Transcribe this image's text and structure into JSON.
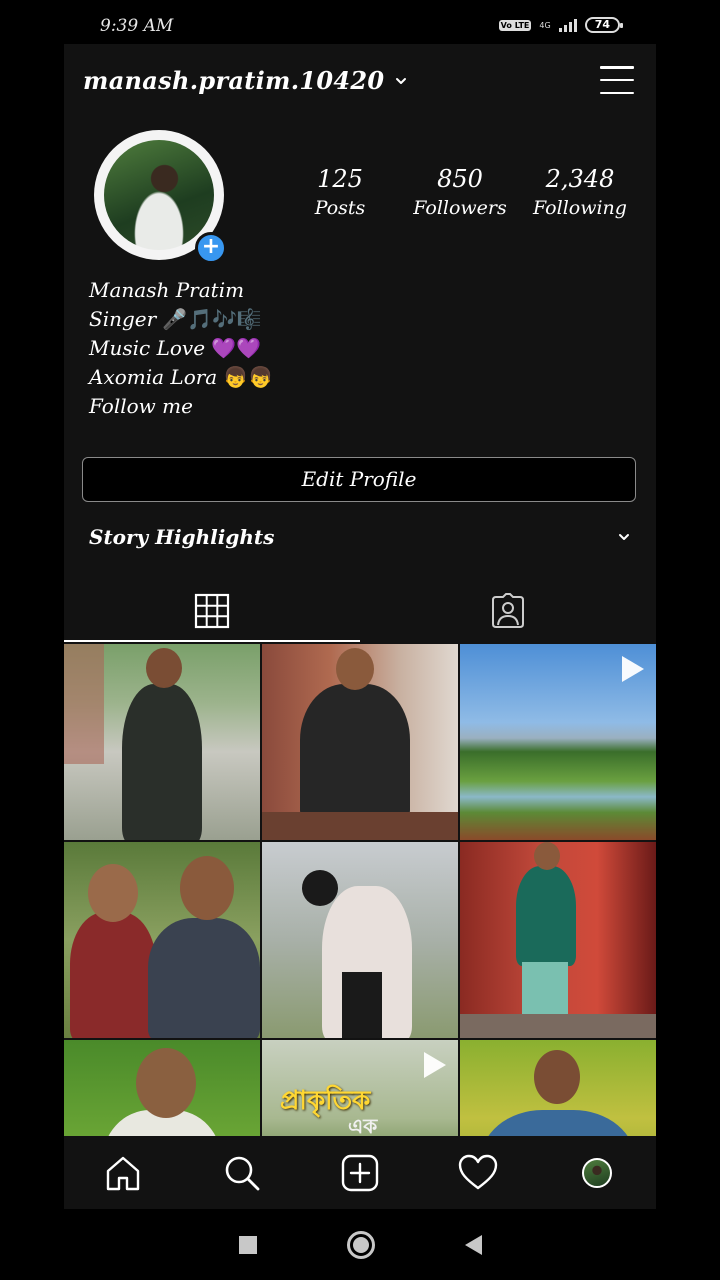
{
  "status_bar": {
    "time": "9:39 AM",
    "network_badge": "Vo LTE",
    "network_type": "4G",
    "battery": "74"
  },
  "header": {
    "username": "manash.pratim.10420",
    "dropdown_icon": "chevron-down-icon",
    "menu_icon": "hamburger-menu-icon"
  },
  "profile": {
    "avatar_badge": "+",
    "stats": [
      {
        "value": "125",
        "label": "Posts"
      },
      {
        "value": "850",
        "label": "Followers"
      },
      {
        "value": "2,348",
        "label": "Following"
      }
    ],
    "bio": [
      {
        "text": "Manash Pratim",
        "emoji": ""
      },
      {
        "text": "Singer",
        "emoji": "🎤🎵🎶🎼"
      },
      {
        "text": "Music Love",
        "emoji": "💜💜"
      },
      {
        "text": "Axomia Lora",
        "emoji": "👦👦"
      },
      {
        "text": "Follow me",
        "emoji": ""
      }
    ],
    "edit_profile_label": "Edit Profile",
    "story_highlights_label": "Story Highlights"
  },
  "tabs": [
    {
      "name": "grid",
      "icon": "grid-icon",
      "active": true
    },
    {
      "name": "tagged",
      "icon": "tagged-person-icon",
      "active": false
    }
  ],
  "posts": [
    {
      "kind": "photo",
      "video": false
    },
    {
      "kind": "photo",
      "video": false
    },
    {
      "kind": "landscape",
      "video": true
    },
    {
      "kind": "photo",
      "video": false
    },
    {
      "kind": "photo",
      "video": false
    },
    {
      "kind": "photo",
      "video": false
    },
    {
      "kind": "photo",
      "video": false
    },
    {
      "kind": "text-video",
      "video": true,
      "overlay_line1": "প্রাকৃতিক",
      "overlay_line2": "এক"
    },
    {
      "kind": "photo",
      "video": false
    }
  ],
  "bottom_nav": [
    {
      "name": "home",
      "icon": "home-icon"
    },
    {
      "name": "search",
      "icon": "search-icon"
    },
    {
      "name": "new-post",
      "icon": "add-post-icon"
    },
    {
      "name": "activity",
      "icon": "heart-icon"
    },
    {
      "name": "profile",
      "icon": "profile-avatar-icon"
    }
  ],
  "colors": {
    "background": "#000000",
    "surface": "#121212",
    "accent": "#3897f0",
    "text": "#ffffff"
  }
}
